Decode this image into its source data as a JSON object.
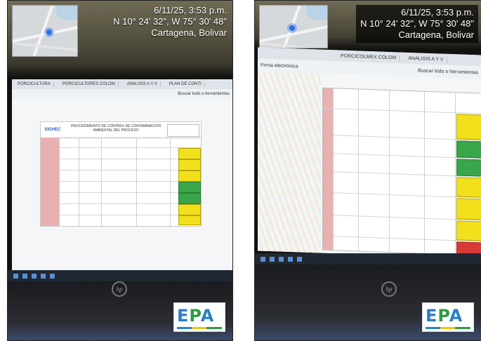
{
  "photos": [
    {
      "geotag": {
        "datetime": "6/11/25, 3:53 p.m.",
        "coords": "N 10° 24' 32\", W 75° 30' 48\"",
        "place": "Cartagena, Bolivar"
      },
      "screen": {
        "tabs": [
          "PORCICULTURA",
          "PORCICULTORES COLOM",
          "ANALISIS A Y V",
          "PLAN DE CONTI"
        ],
        "search_label": "Buscar todo o herramientas",
        "doc_logo": "SIGHEC",
        "doc_title": "PROCEDIMIENTO DE CONTROL DE CONTAMINACIÓN AMBIENTAL DEL PROCESO"
      },
      "logo": {
        "text_e": "E",
        "text_p": "P",
        "text_a": "A"
      }
    },
    {
      "geotag": {
        "datetime": "6/11/25, 3:53 p.m.",
        "coords": "N 10° 24' 32\", W 75° 30' 48\"",
        "place": "Cartagena, Bolivar"
      },
      "screen": {
        "tabs": [
          "PORCICOLMEX COLOM",
          "ANALISIS A Y V"
        ],
        "left_label": "Firma electrónica",
        "search_label": "Buscar todo o herramientas"
      },
      "logo": {
        "text_e": "E",
        "text_p": "P",
        "text_a": "A"
      }
    }
  ],
  "colors": {
    "risk_yellow": "#f2e01c",
    "risk_green": "#3aa64a",
    "risk_red": "#d83a35",
    "epa_blue": "#2b7fc3",
    "epa_green": "#2f9a46"
  }
}
